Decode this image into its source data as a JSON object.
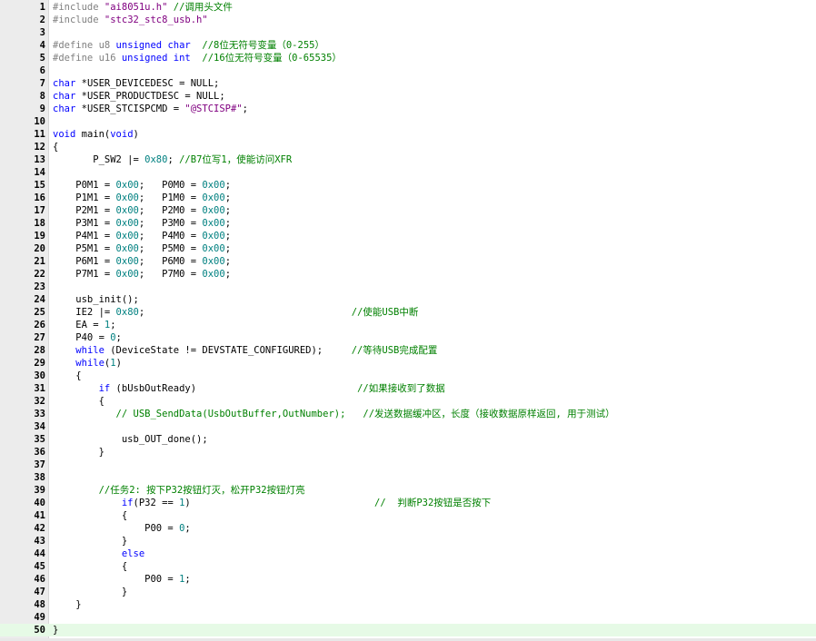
{
  "colors": {
    "keyword": "#0000ff",
    "string": "#800080",
    "number": "#008080",
    "comment": "#008000",
    "preprocessor": "#808080",
    "text": "#000000",
    "current_line_bg": "#e6fae6"
  },
  "editor": {
    "current_line": 50,
    "lines": [
      {
        "n": "1",
        "tokens": [
          {
            "t": "pp",
            "v": "#include "
          },
          {
            "t": "str",
            "v": "\"ai8051u.h\""
          },
          {
            "t": "txt",
            "v": " "
          },
          {
            "t": "cmt",
            "v": "//调用头文件"
          }
        ]
      },
      {
        "n": "2",
        "tokens": [
          {
            "t": "pp",
            "v": "#include "
          },
          {
            "t": "str",
            "v": "\"stc32_stc8_usb.h\""
          }
        ]
      },
      {
        "n": "3",
        "tokens": []
      },
      {
        "n": "4",
        "tokens": [
          {
            "t": "pp",
            "v": "#define u8 "
          },
          {
            "t": "kw",
            "v": "unsigned char"
          },
          {
            "t": "txt",
            "v": "  "
          },
          {
            "t": "cmt",
            "v": "//8位无符号变量（0-255）"
          }
        ]
      },
      {
        "n": "5",
        "tokens": [
          {
            "t": "pp",
            "v": "#define u16 "
          },
          {
            "t": "kw",
            "v": "unsigned int"
          },
          {
            "t": "txt",
            "v": "  "
          },
          {
            "t": "cmt",
            "v": "//16位无符号变量（0-65535）"
          }
        ]
      },
      {
        "n": "6",
        "tokens": []
      },
      {
        "n": "7",
        "tokens": [
          {
            "t": "kw",
            "v": "char"
          },
          {
            "t": "txt",
            "v": " *USER_DEVICEDESC = NULL;"
          }
        ]
      },
      {
        "n": "8",
        "tokens": [
          {
            "t": "kw",
            "v": "char"
          },
          {
            "t": "txt",
            "v": " *USER_PRODUCTDESC = NULL;"
          }
        ]
      },
      {
        "n": "9",
        "tokens": [
          {
            "t": "kw",
            "v": "char"
          },
          {
            "t": "txt",
            "v": " *USER_STCISPCMD = "
          },
          {
            "t": "str",
            "v": "\"@STCISP#\""
          },
          {
            "t": "txt",
            "v": ";"
          }
        ]
      },
      {
        "n": "10",
        "tokens": []
      },
      {
        "n": "11",
        "tokens": [
          {
            "t": "kw",
            "v": "void"
          },
          {
            "t": "txt",
            "v": " main("
          },
          {
            "t": "kw",
            "v": "void"
          },
          {
            "t": "txt",
            "v": ")"
          }
        ]
      },
      {
        "n": "12",
        "tokens": [
          {
            "t": "txt",
            "v": "{"
          }
        ]
      },
      {
        "n": "13",
        "tokens": [
          {
            "t": "txt",
            "v": "       P_SW2 |= "
          },
          {
            "t": "num",
            "v": "0x80"
          },
          {
            "t": "txt",
            "v": "; "
          },
          {
            "t": "cmt",
            "v": "//B7位写1，使能访问XFR"
          }
        ]
      },
      {
        "n": "14",
        "tokens": []
      },
      {
        "n": "15",
        "tokens": [
          {
            "t": "txt",
            "v": "    P0M1 = "
          },
          {
            "t": "num",
            "v": "0x00"
          },
          {
            "t": "txt",
            "v": ";   P0M0 = "
          },
          {
            "t": "num",
            "v": "0x00"
          },
          {
            "t": "txt",
            "v": ";"
          }
        ]
      },
      {
        "n": "16",
        "tokens": [
          {
            "t": "txt",
            "v": "    P1M1 = "
          },
          {
            "t": "num",
            "v": "0x00"
          },
          {
            "t": "txt",
            "v": ";   P1M0 = "
          },
          {
            "t": "num",
            "v": "0x00"
          },
          {
            "t": "txt",
            "v": ";"
          }
        ]
      },
      {
        "n": "17",
        "tokens": [
          {
            "t": "txt",
            "v": "    P2M1 = "
          },
          {
            "t": "num",
            "v": "0x00"
          },
          {
            "t": "txt",
            "v": ";   P2M0 = "
          },
          {
            "t": "num",
            "v": "0x00"
          },
          {
            "t": "txt",
            "v": ";"
          }
        ]
      },
      {
        "n": "18",
        "tokens": [
          {
            "t": "txt",
            "v": "    P3M1 = "
          },
          {
            "t": "num",
            "v": "0x00"
          },
          {
            "t": "txt",
            "v": ";   P3M0 = "
          },
          {
            "t": "num",
            "v": "0x00"
          },
          {
            "t": "txt",
            "v": ";"
          }
        ]
      },
      {
        "n": "19",
        "tokens": [
          {
            "t": "txt",
            "v": "    P4M1 = "
          },
          {
            "t": "num",
            "v": "0x00"
          },
          {
            "t": "txt",
            "v": ";   P4M0 = "
          },
          {
            "t": "num",
            "v": "0x00"
          },
          {
            "t": "txt",
            "v": ";"
          }
        ]
      },
      {
        "n": "20",
        "tokens": [
          {
            "t": "txt",
            "v": "    P5M1 = "
          },
          {
            "t": "num",
            "v": "0x00"
          },
          {
            "t": "txt",
            "v": ";   P5M0 = "
          },
          {
            "t": "num",
            "v": "0x00"
          },
          {
            "t": "txt",
            "v": ";"
          }
        ]
      },
      {
        "n": "21",
        "tokens": [
          {
            "t": "txt",
            "v": "    P6M1 = "
          },
          {
            "t": "num",
            "v": "0x00"
          },
          {
            "t": "txt",
            "v": ";   P6M0 = "
          },
          {
            "t": "num",
            "v": "0x00"
          },
          {
            "t": "txt",
            "v": ";"
          }
        ]
      },
      {
        "n": "22",
        "tokens": [
          {
            "t": "txt",
            "v": "    P7M1 = "
          },
          {
            "t": "num",
            "v": "0x00"
          },
          {
            "t": "txt",
            "v": ";   P7M0 = "
          },
          {
            "t": "num",
            "v": "0x00"
          },
          {
            "t": "txt",
            "v": ";"
          }
        ]
      },
      {
        "n": "23",
        "tokens": []
      },
      {
        "n": "24",
        "tokens": [
          {
            "t": "txt",
            "v": "    usb_init();"
          }
        ]
      },
      {
        "n": "25",
        "tokens": [
          {
            "t": "txt",
            "v": "    IE2 |= "
          },
          {
            "t": "num",
            "v": "0x80"
          },
          {
            "t": "txt",
            "v": ";                                    "
          },
          {
            "t": "cmt",
            "v": "//使能USB中断"
          }
        ]
      },
      {
        "n": "26",
        "tokens": [
          {
            "t": "txt",
            "v": "    EA = "
          },
          {
            "t": "num",
            "v": "1"
          },
          {
            "t": "txt",
            "v": ";"
          }
        ]
      },
      {
        "n": "27",
        "tokens": [
          {
            "t": "txt",
            "v": "    P40 = "
          },
          {
            "t": "num",
            "v": "0"
          },
          {
            "t": "txt",
            "v": ";"
          }
        ]
      },
      {
        "n": "28",
        "tokens": [
          {
            "t": "txt",
            "v": "    "
          },
          {
            "t": "kw",
            "v": "while"
          },
          {
            "t": "txt",
            "v": " (DeviceState != DEVSTATE_CONFIGURED);     "
          },
          {
            "t": "cmt",
            "v": "//等待USB完成配置"
          }
        ]
      },
      {
        "n": "29",
        "tokens": [
          {
            "t": "txt",
            "v": "    "
          },
          {
            "t": "kw",
            "v": "while"
          },
          {
            "t": "txt",
            "v": "("
          },
          {
            "t": "num",
            "v": "1"
          },
          {
            "t": "txt",
            "v": ")"
          }
        ]
      },
      {
        "n": "30",
        "tokens": [
          {
            "t": "txt",
            "v": "    {"
          }
        ]
      },
      {
        "n": "31",
        "tokens": [
          {
            "t": "txt",
            "v": "        "
          },
          {
            "t": "kw",
            "v": "if"
          },
          {
            "t": "txt",
            "v": " (bUsbOutReady)                            "
          },
          {
            "t": "cmt",
            "v": "//如果接收到了数据"
          }
        ]
      },
      {
        "n": "32",
        "tokens": [
          {
            "t": "txt",
            "v": "        {"
          }
        ]
      },
      {
        "n": "33",
        "tokens": [
          {
            "t": "txt",
            "v": "           "
          },
          {
            "t": "cmt",
            "v": "// USB_SendData(UsbOutBuffer,OutNumber);   //发送数据缓冲区，长度（接收数据原样返回, 用于测试）"
          }
        ]
      },
      {
        "n": "34",
        "tokens": []
      },
      {
        "n": "35",
        "tokens": [
          {
            "t": "txt",
            "v": "            usb_OUT_done();"
          }
        ]
      },
      {
        "n": "36",
        "tokens": [
          {
            "t": "txt",
            "v": "        }"
          }
        ]
      },
      {
        "n": "37",
        "tokens": []
      },
      {
        "n": "38",
        "tokens": []
      },
      {
        "n": "39",
        "tokens": [
          {
            "t": "txt",
            "v": "        "
          },
          {
            "t": "cmt",
            "v": "//任务2: 按下P32按钮灯灭，松开P32按钮灯亮"
          }
        ]
      },
      {
        "n": "40",
        "tokens": [
          {
            "t": "txt",
            "v": "            "
          },
          {
            "t": "kw",
            "v": "if"
          },
          {
            "t": "txt",
            "v": "(P32 == "
          },
          {
            "t": "num",
            "v": "1"
          },
          {
            "t": "txt",
            "v": ")                                "
          },
          {
            "t": "cmt",
            "v": "//  判断P32按钮是否按下"
          }
        ]
      },
      {
        "n": "41",
        "tokens": [
          {
            "t": "txt",
            "v": "            {"
          }
        ]
      },
      {
        "n": "42",
        "tokens": [
          {
            "t": "txt",
            "v": "                P00 = "
          },
          {
            "t": "num",
            "v": "0"
          },
          {
            "t": "txt",
            "v": ";"
          }
        ]
      },
      {
        "n": "43",
        "tokens": [
          {
            "t": "txt",
            "v": "            }"
          }
        ]
      },
      {
        "n": "44",
        "tokens": [
          {
            "t": "txt",
            "v": "            "
          },
          {
            "t": "kw",
            "v": "else"
          }
        ]
      },
      {
        "n": "45",
        "tokens": [
          {
            "t": "txt",
            "v": "            {"
          }
        ]
      },
      {
        "n": "46",
        "tokens": [
          {
            "t": "txt",
            "v": "                P00 = "
          },
          {
            "t": "num",
            "v": "1"
          },
          {
            "t": "txt",
            "v": ";"
          }
        ]
      },
      {
        "n": "47",
        "tokens": [
          {
            "t": "txt",
            "v": "            }"
          }
        ]
      },
      {
        "n": "48",
        "tokens": [
          {
            "t": "txt",
            "v": "    }"
          }
        ]
      },
      {
        "n": "49",
        "tokens": []
      },
      {
        "n": "50",
        "tokens": [
          {
            "t": "txt",
            "v": "}"
          }
        ]
      }
    ]
  }
}
